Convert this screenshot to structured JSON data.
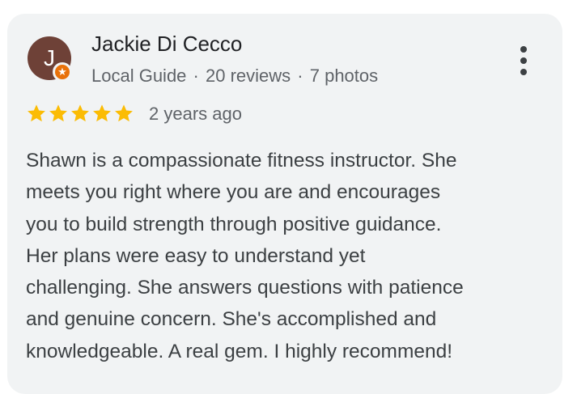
{
  "review": {
    "avatar_letter": "J",
    "author_name": "Jackie Di Cecco",
    "badge_icon": "local-guide-star-icon",
    "meta": {
      "role": "Local Guide",
      "reviews": "20 reviews",
      "photos": "7 photos",
      "separator": "·"
    },
    "rating": 5,
    "rating_max": 5,
    "time": "2 years ago",
    "text_lines": [
      "Shawn is a compassionate fitness instructor. She",
      "meets you right where you are and encourages",
      "you to build strength through positive guidance.",
      "Her plans were easy to understand yet",
      "challenging. She answers questions with patience",
      "and genuine concern. She's accomplished and",
      "knowledgeable. A real gem. I highly recommend!"
    ]
  },
  "colors": {
    "card_bg": "#f1f3f4",
    "avatar_bg": "#6e4137",
    "badge": "#e8710a",
    "star": "#fbbc04",
    "name": "#202124",
    "meta": "#5f6368",
    "body": "#3c4043"
  }
}
